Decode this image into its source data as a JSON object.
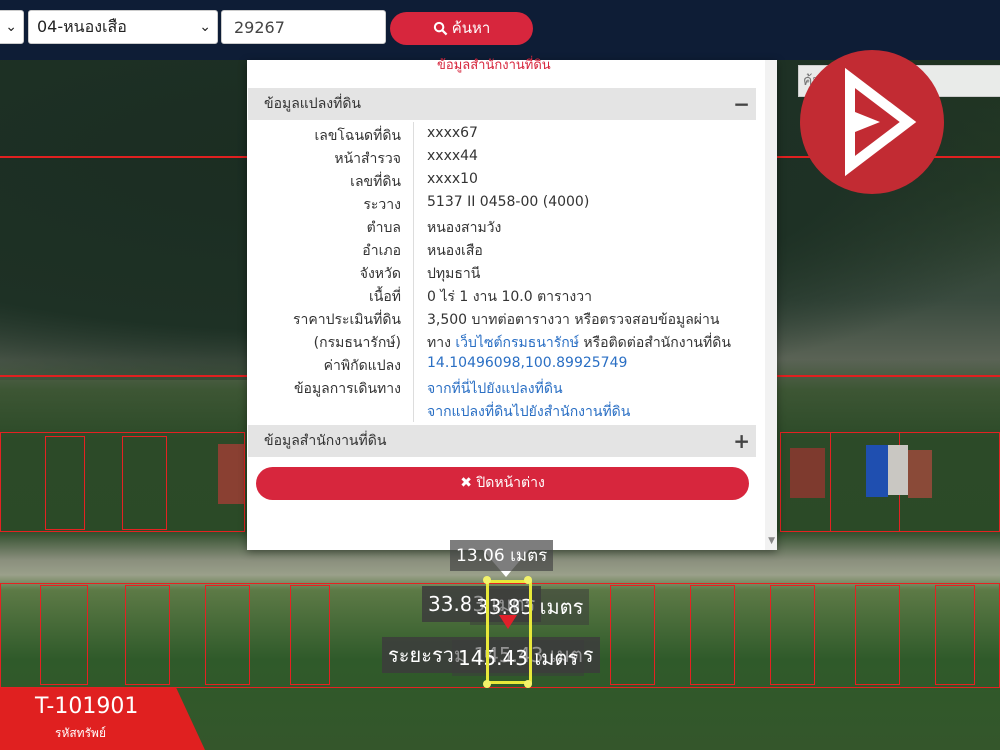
{
  "topbar": {
    "district_value": "",
    "subdistrict_value": "04-หนองเสือ",
    "deed_number": "29267",
    "search_label": "ค้นหา"
  },
  "map": {
    "search_placeholder": "ค้นหาสถานที่สำคัญ",
    "measurements": {
      "top_label": "13.06 เมตร",
      "width_label": "33.83 เมตร",
      "width_label_2": "33.83 เมตร",
      "depth_label": "ระยะรวม 145.43 เมตร",
      "depth_label_2": "145.43 เมตร"
    }
  },
  "popup": {
    "top_partial_text": "ข้อมูลสำนักงานที่ดิน",
    "land_section_title": "ข้อมูลแปลงที่ดิน",
    "land_section_toggle": "−",
    "rows": [
      {
        "label": "เลขโฉนดที่ดิน",
        "value": "xxxx67"
      },
      {
        "label": "หน้าสำรวจ",
        "value": "xxxx44"
      },
      {
        "label": "เลขที่ดิน",
        "value": "xxxx10"
      },
      {
        "label": "ระวาง",
        "value": "5137 II 0458-00 (4000)"
      },
      {
        "label": "ตำบล",
        "value": "หนองสามวัง"
      },
      {
        "label": "อำเภอ",
        "value": "หนองเสือ"
      },
      {
        "label": "จังหวัด",
        "value": "ปทุมธานี"
      },
      {
        "label": "เนื้อที่",
        "value": "0 ไร่ 1 งาน 10.0 ตารางวา"
      },
      {
        "label": "ราคาประเมินที่ดิน",
        "value": "3,500 บาทต่อตารางวา หรือตรวจสอบข้อมูลผ่าน"
      },
      {
        "label": "(กรมธนารักษ์)",
        "value_pre": "ทาง ",
        "value_link": "เว็บไซต์กรมธนารักษ์",
        "value_post": " หรือติดต่อสำนักงานที่ดิน"
      },
      {
        "label": "ค่าพิกัดแปลง",
        "value": "14.10496098,100.89925749"
      },
      {
        "label": "ข้อมูลการเดินทาง",
        "value": "จากที่นี่ไปยังแปลงที่ดิน"
      },
      {
        "label": "",
        "value": "จากแปลงที่ดินไปยังสำนักงานที่ดิน"
      }
    ],
    "office_section_title": "ข้อมูลสำนักงานที่ดิน",
    "office_section_toggle": "+",
    "close_label": "ปิดหน้าต่าง"
  },
  "property": {
    "code": "T-101901",
    "code_label": "รหัสทรัพย์"
  },
  "colors": {
    "accent": "#d7263d",
    "topbar": "#0e1d36",
    "link": "#2a6fc4",
    "plot_outline": "#e8e83a"
  },
  "icons": [
    "chevron-down-icon",
    "search-icon",
    "minus-icon",
    "plus-icon",
    "close-x-icon",
    "brand-logo-icon",
    "location-pin-icon"
  ]
}
